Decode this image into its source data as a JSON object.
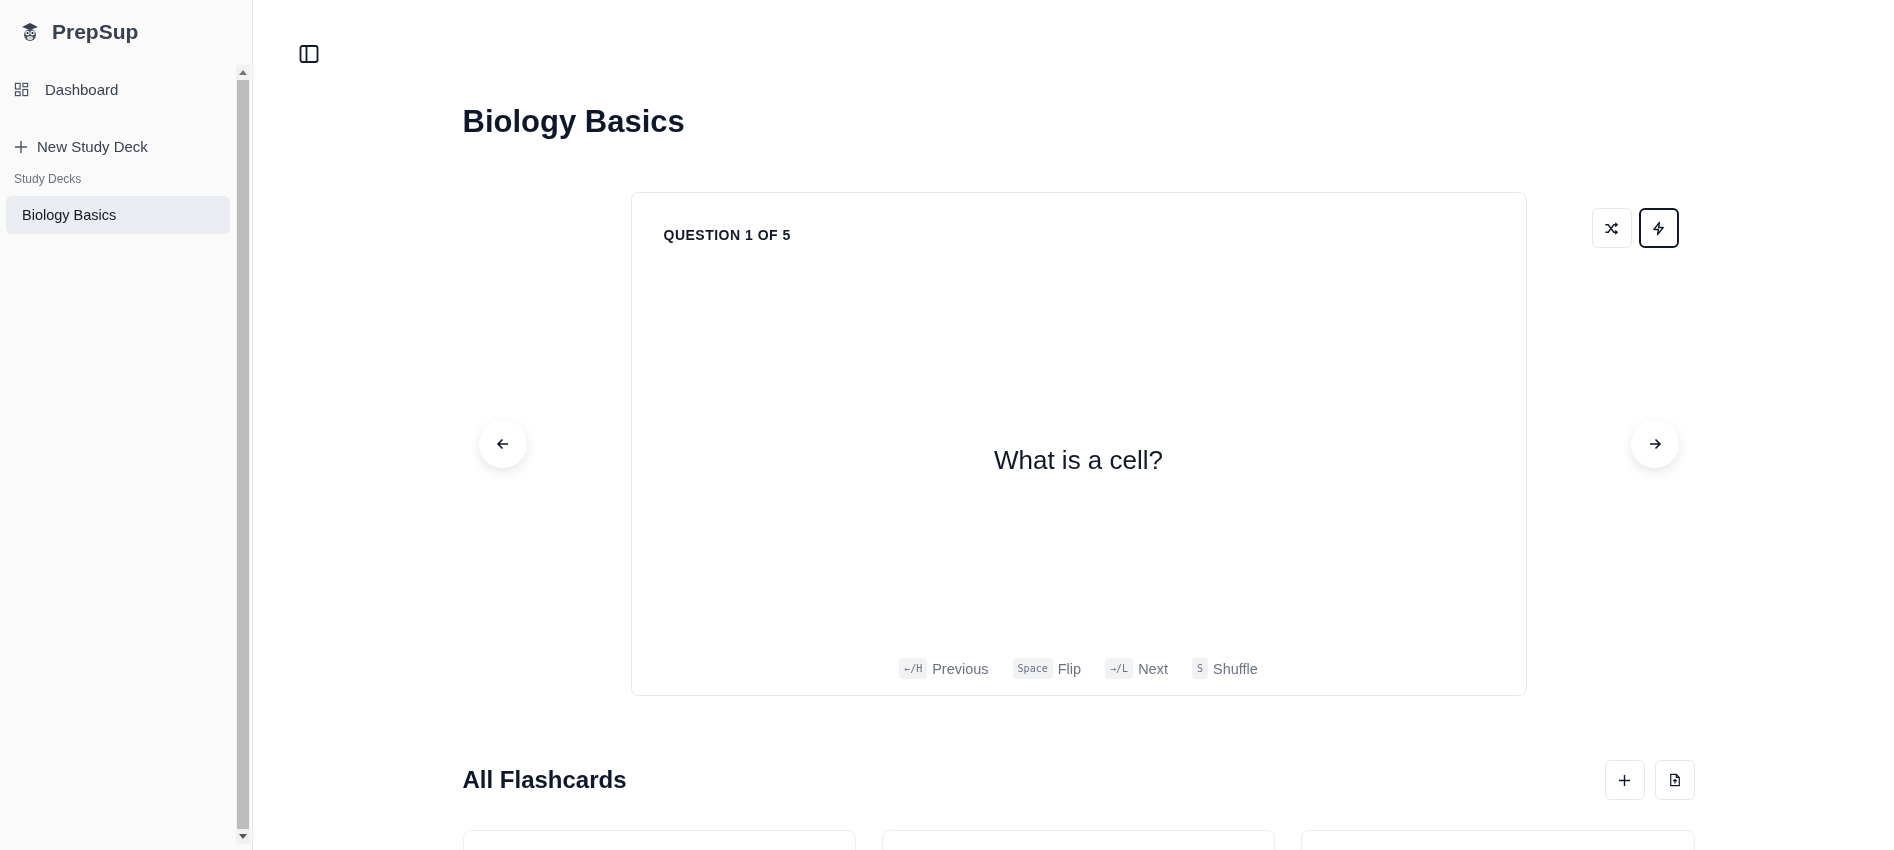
{
  "sidebar": {
    "brand": "PrepSup",
    "nav": [
      {
        "kind": "dashboard",
        "label": "Dashboard"
      }
    ],
    "new_deck": "New Study Deck",
    "section_label": "Study Decks",
    "decks": [
      {
        "label": "Biology Basics",
        "selected": true
      }
    ]
  },
  "main": {
    "title": "Biology Basics",
    "card": {
      "counter": "QUESTION 1 OF 5",
      "question": "What is a cell?",
      "shortcuts": [
        {
          "key": "←/H",
          "label": "Previous"
        },
        {
          "key": "Space",
          "label": "Flip"
        },
        {
          "key": "→/L",
          "label": "Next"
        },
        {
          "key": "S",
          "label": "Shuffle"
        }
      ]
    },
    "tools": [
      {
        "kind": "shuffle",
        "selected": false
      },
      {
        "kind": "lightning",
        "selected": true
      }
    ],
    "flashcards": {
      "title": "All Flashcards",
      "actions": [
        {
          "kind": "add"
        },
        {
          "kind": "upload"
        }
      ],
      "cards": [
        {
          "kind": "blank"
        },
        {
          "kind": "blank"
        },
        {
          "kind": "blank"
        }
      ]
    }
  }
}
